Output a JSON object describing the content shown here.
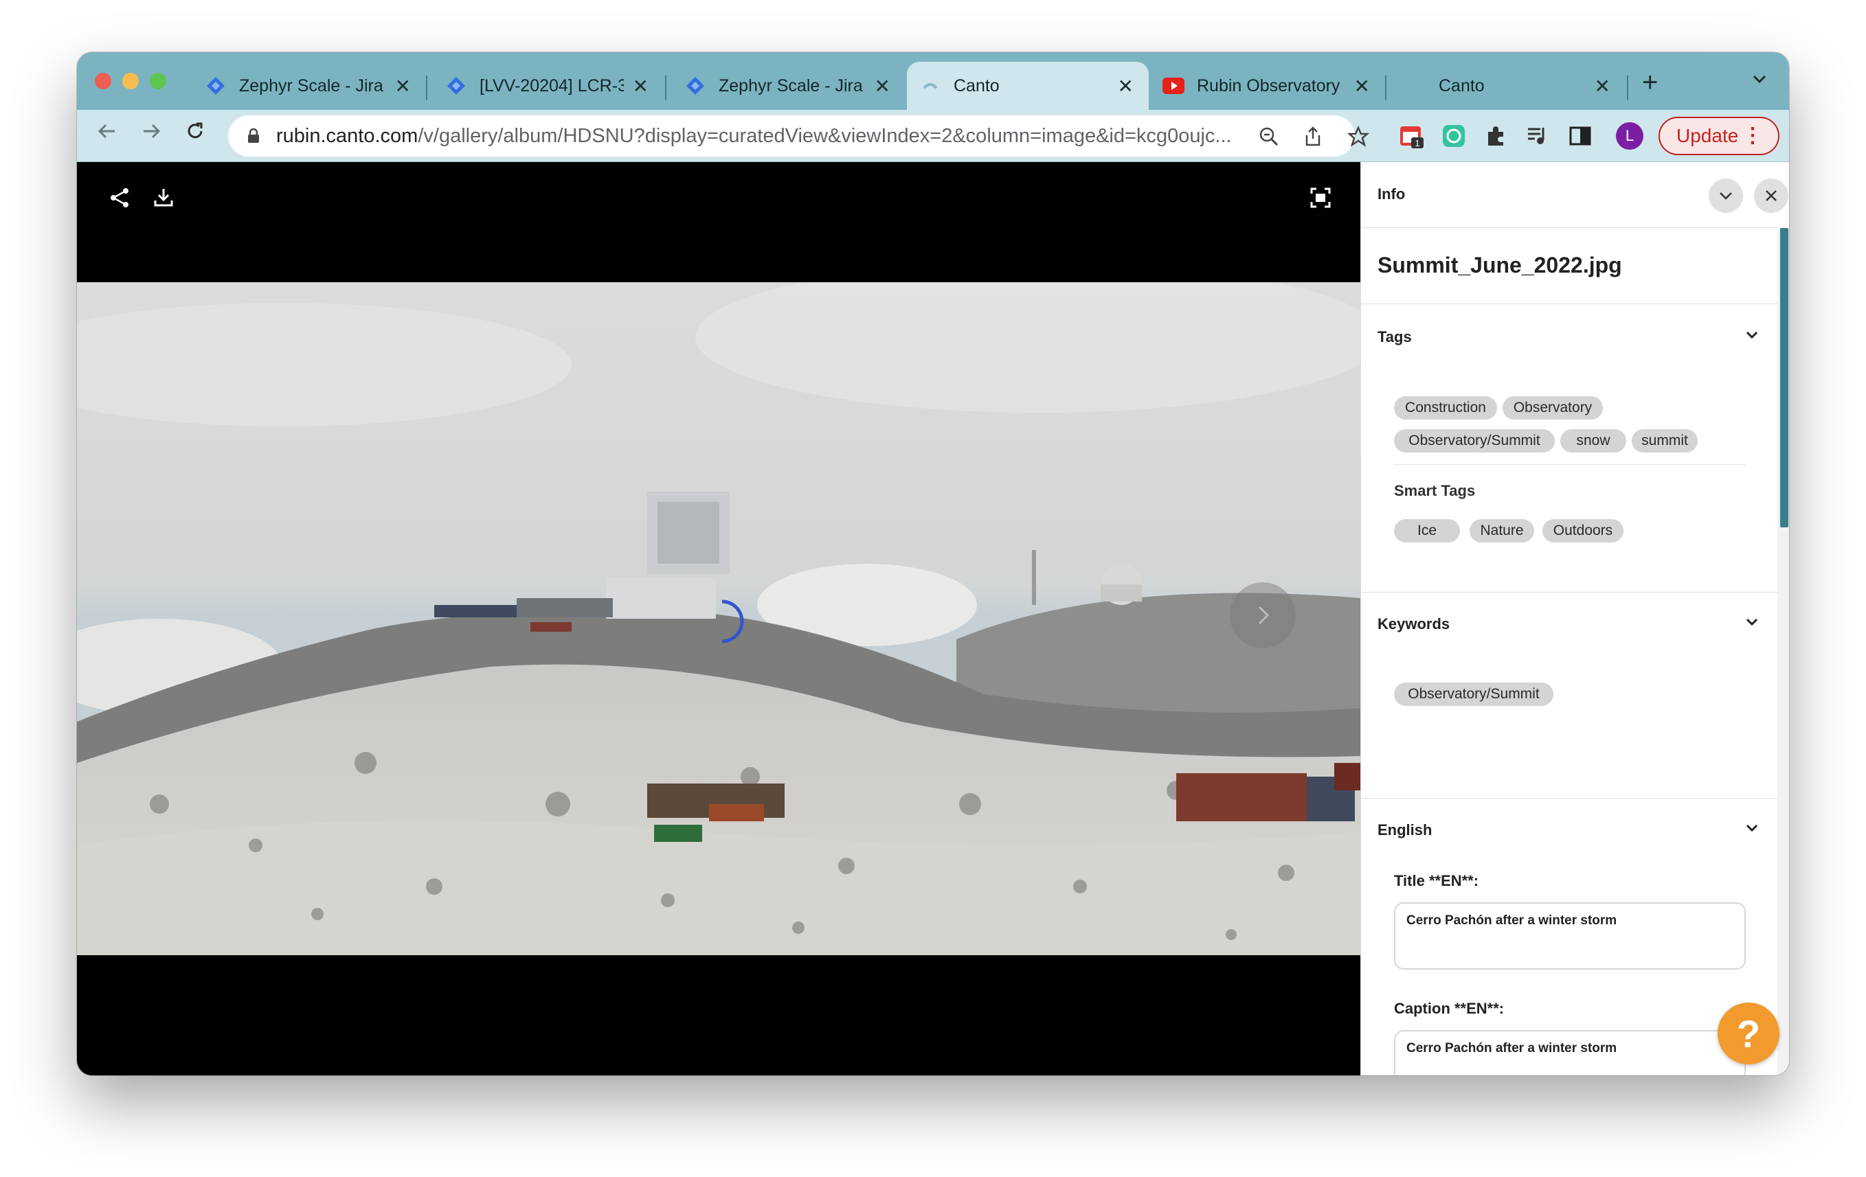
{
  "browser": {
    "tabs": [
      {
        "title": "Zephyr Scale - Jira",
        "icon": "jira-diamond-icon"
      },
      {
        "title": "[LVV-20204] LCR-3",
        "icon": "jira-diamond-icon"
      },
      {
        "title": "Zephyr Scale - Jira",
        "icon": "jira-diamond-icon"
      },
      {
        "title": "Canto",
        "icon": "canto-icon",
        "active": true
      },
      {
        "title": "Rubin Observatory",
        "icon": "youtube-icon"
      },
      {
        "title": "Canto",
        "icon": "blank-page-icon"
      }
    ],
    "tab_close_glyph": "✕",
    "new_tab_glyph": "+",
    "url_host": "rubin.canto.com",
    "url_path": "/v/gallery/album/HDSNU?display=curatedView&viewIndex=2&column=image&id=kcg0oujc...",
    "extension_badge": "1",
    "profile_initial": "L",
    "update_label": "Update",
    "accent_colors": {
      "tabstrip": "#7bb4c0",
      "toolbar": "#cfe6ec",
      "update": "#c5221f",
      "profile": "#7b1fa2"
    }
  },
  "viewer": {
    "image_alt": "Snowy summit with observatory buildings and shipping containers"
  },
  "panel": {
    "title": "Info",
    "filename": "Summit_June_2022.jpg",
    "tags_title": "Tags",
    "tags": [
      "Construction",
      "Observatory",
      "Observatory/Summit",
      "snow",
      "summit"
    ],
    "smart_tags_title": "Smart Tags",
    "smart_tags": [
      "Ice",
      "Nature",
      "Outdoors"
    ],
    "keywords_title": "Keywords",
    "keywords": [
      "Observatory/Summit"
    ],
    "english_title": "English",
    "title_label": "Title **EN**:",
    "title_value": "Cerro Pachón after a winter storm",
    "caption_label": "Caption **EN**:",
    "caption_value": "Cerro Pachón after a winter storm",
    "help_glyph": "?"
  }
}
